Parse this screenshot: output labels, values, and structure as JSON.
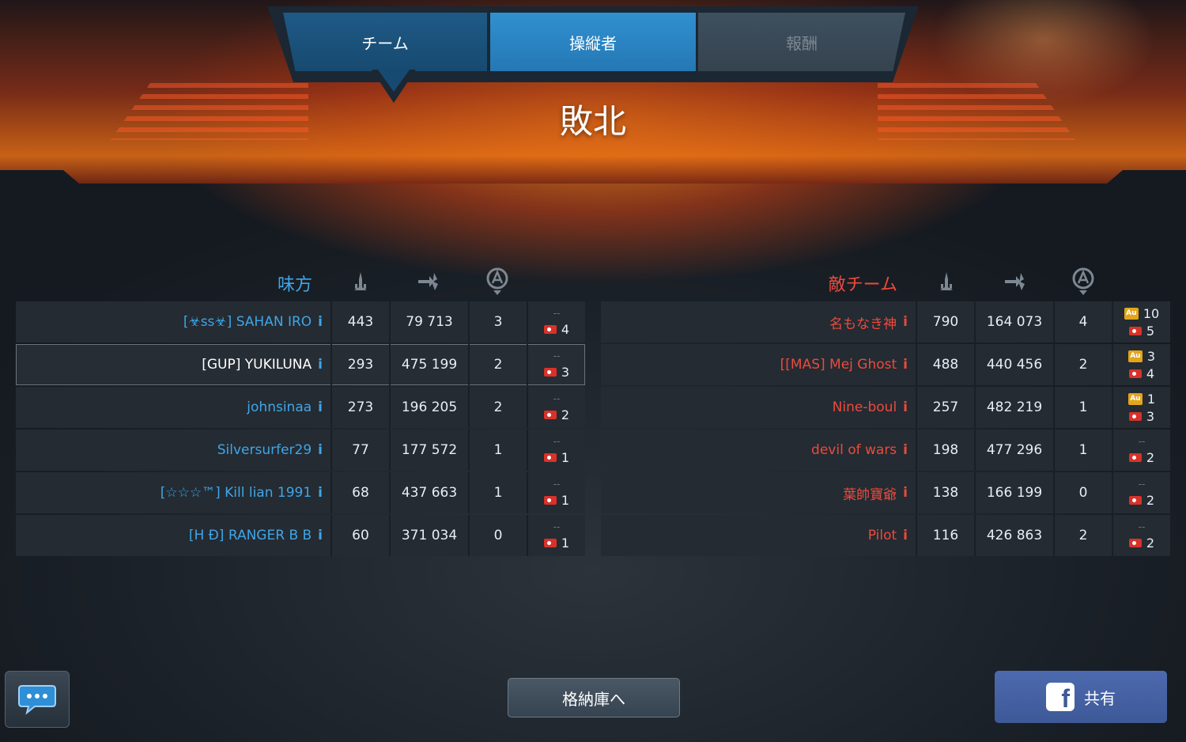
{
  "tabs": {
    "team": "チーム",
    "pilots": "操縦者",
    "rewards": "報酬"
  },
  "result": "敗北",
  "ally": {
    "header": "味方",
    "rows": [
      {
        "name": "[☣ss☣] SAHAN IRO",
        "kills": "443",
        "damage": "79 713",
        "capture": "3",
        "gold": "--",
        "tickets": "4",
        "highlight": false
      },
      {
        "name": "[GUP] YUKILUNA",
        "kills": "293",
        "damage": "475 199",
        "capture": "2",
        "gold": "--",
        "tickets": "3",
        "highlight": true
      },
      {
        "name": "johnsinaa",
        "kills": "273",
        "damage": "196 205",
        "capture": "2",
        "gold": "--",
        "tickets": "2",
        "highlight": false
      },
      {
        "name": "Silversurfer29",
        "kills": "77",
        "damage": "177 572",
        "capture": "1",
        "gold": "--",
        "tickets": "1",
        "highlight": false
      },
      {
        "name": "[☆☆☆™] Kill lian 1991",
        "kills": "68",
        "damage": "437 663",
        "capture": "1",
        "gold": "--",
        "tickets": "1",
        "highlight": false
      },
      {
        "name": "[H Ð] RANGER B B",
        "kills": "60",
        "damage": "371 034",
        "capture": "0",
        "gold": "--",
        "tickets": "1",
        "highlight": false
      }
    ]
  },
  "enemy": {
    "header": "敵チーム",
    "rows": [
      {
        "name": "名もなき神",
        "kills": "790",
        "damage": "164 073",
        "capture": "4",
        "gold": "10",
        "tickets": "5"
      },
      {
        "name": "[[MAS] Mej Ghost",
        "kills": "488",
        "damage": "440 456",
        "capture": "2",
        "gold": "3",
        "tickets": "4"
      },
      {
        "name": "Nine-boul",
        "kills": "257",
        "damage": "482 219",
        "capture": "1",
        "gold": "1",
        "tickets": "3"
      },
      {
        "name": "devil of wars",
        "kills": "198",
        "damage": "477 296",
        "capture": "1",
        "gold": "--",
        "tickets": "2"
      },
      {
        "name": "葉帥寶爺",
        "kills": "138",
        "damage": "166 199",
        "capture": "0",
        "gold": "--",
        "tickets": "2"
      },
      {
        "name": "Pilot",
        "kills": "116",
        "damage": "426 863",
        "capture": "2",
        "gold": "--",
        "tickets": "2"
      }
    ]
  },
  "icons": {
    "info": "i",
    "gold_badge": "Au",
    "facebook": "f"
  },
  "buttons": {
    "hangar": "格納庫へ",
    "share": "共有"
  },
  "colors": {
    "ally": "#3fa6e8",
    "enemy": "#ec4a3c",
    "active_tab": "#2a86c6",
    "ticket": "#d8322a",
    "gold": "#e3a51b"
  }
}
